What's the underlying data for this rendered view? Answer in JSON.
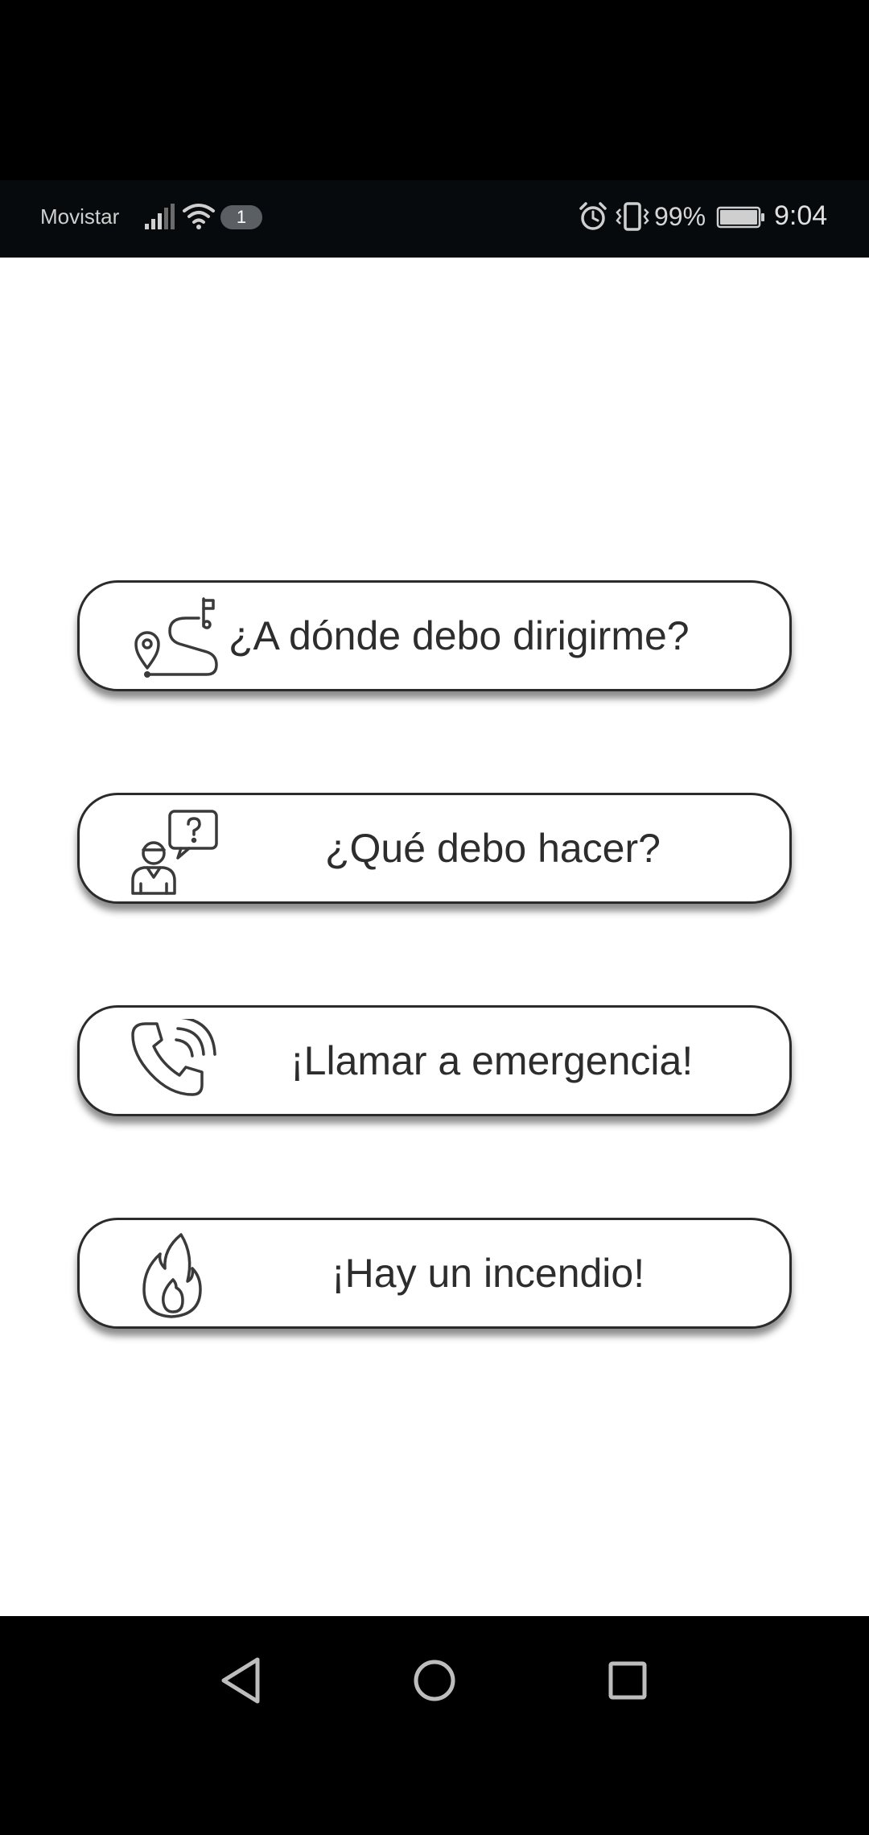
{
  "status_bar": {
    "carrier": "Movistar",
    "notification_count": "1",
    "battery_percent": "99%",
    "time": "9:04"
  },
  "menu": [
    {
      "label": "¿A dónde debo dirigirme?",
      "icon": "route-pin-icon"
    },
    {
      "label": "¿Qué debo hacer?",
      "icon": "person-question-icon"
    },
    {
      "label": "¡Llamar a emergencia!",
      "icon": "phone-ringing-icon"
    },
    {
      "label": "¡Hay un incendio!",
      "icon": "fire-icon"
    }
  ],
  "nav": {
    "back": "back-triangle-icon",
    "home": "home-circle-icon",
    "recents": "recents-square-icon"
  },
  "colors": {
    "status_bar_bg": "#060a0d",
    "content_bg": "#ffffff",
    "button_border": "#2b2b2b",
    "button_text": "#2d2d2d",
    "nav_bg": "#000000"
  }
}
